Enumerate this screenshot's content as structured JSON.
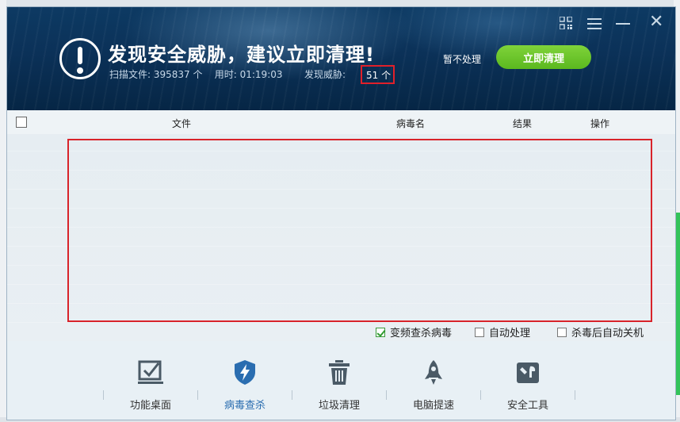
{
  "dialog": {
    "title": "发现安全威胁，建议立即清理!",
    "stats": {
      "scanned_label": "扫描文件: 395837 个",
      "time_label": "用时: 01:19:03",
      "threat_label": "发现威胁:",
      "threat_count": "51 个"
    },
    "actions": {
      "skip": "暂不处理",
      "clean": "立即清理"
    },
    "window_controls": [
      "qr-code-icon",
      "menu-icon",
      "minimize-icon",
      "close-icon"
    ],
    "close_glyph": "✕"
  },
  "table": {
    "columns": [
      "文件",
      "病毒名",
      "结果",
      "操作"
    ],
    "rows": []
  },
  "options": [
    {
      "label": "变频查杀病毒",
      "checked": true
    },
    {
      "label": "自动处理",
      "checked": false
    },
    {
      "label": "杀毒后自动关机",
      "checked": false
    }
  ],
  "nav": [
    {
      "label": "功能桌面",
      "icon": "desktop-check-icon",
      "active": false
    },
    {
      "label": "病毒查杀",
      "icon": "shield-bolt-icon",
      "active": true
    },
    {
      "label": "垃圾清理",
      "icon": "trash-icon",
      "active": false
    },
    {
      "label": "电脑提速",
      "icon": "rocket-icon",
      "active": false
    },
    {
      "label": "安全工具",
      "icon": "toolbox-icon",
      "active": false
    }
  ],
  "colors": {
    "header": "#0b3158",
    "clean_button": "#6cc52b",
    "highlight": "#d8232a",
    "active_nav": "#2a6db0"
  }
}
